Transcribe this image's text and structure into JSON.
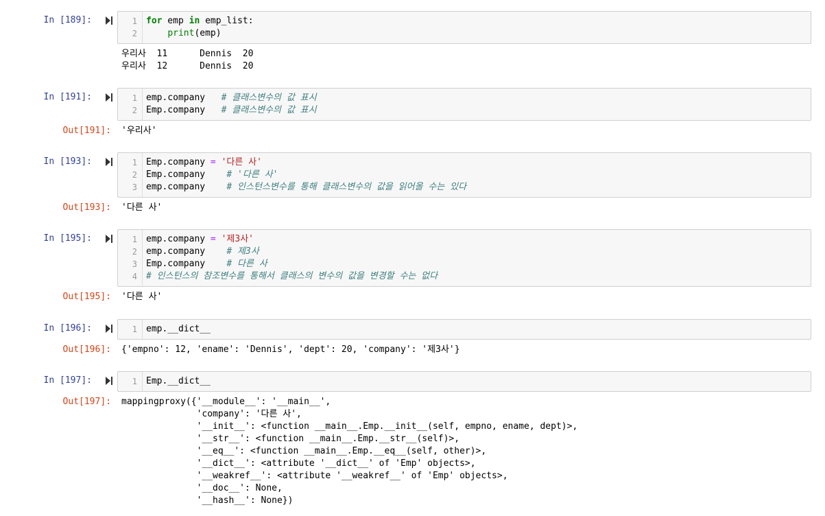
{
  "cells": [
    {
      "prompt": "In [189]:",
      "code": [
        {
          "no": "1",
          "parts": [
            {
              "t": "for",
              "c": "kw"
            },
            {
              "t": " emp "
            },
            {
              "t": "in",
              "c": "kw"
            },
            {
              "t": " emp_list:"
            }
          ]
        },
        {
          "no": "2",
          "parts": [
            {
              "t": "    "
            },
            {
              "t": "print",
              "c": "bi"
            },
            {
              "t": "(emp)"
            }
          ]
        }
      ],
      "output_prompt": "",
      "output": [
        "우리사  11      Dennis  20",
        "우리사  12      Dennis  20"
      ]
    },
    {
      "prompt": "In [191]:",
      "code": [
        {
          "no": "1",
          "parts": [
            {
              "t": "emp.company   "
            },
            {
              "t": "# 클래스변수의 값 표시",
              "c": "cm"
            }
          ]
        },
        {
          "no": "2",
          "parts": [
            {
              "t": "Emp.company   "
            },
            {
              "t": "# 클래스변수의 값 표시",
              "c": "cm"
            }
          ]
        }
      ],
      "output_prompt": "Out[191]:",
      "output": [
        "'우리사'"
      ]
    },
    {
      "prompt": "In [193]:",
      "code": [
        {
          "no": "1",
          "parts": [
            {
              "t": "Emp.company "
            },
            {
              "t": "=",
              "c": "op"
            },
            {
              "t": " "
            },
            {
              "t": "'다른 사'",
              "c": "str"
            }
          ]
        },
        {
          "no": "2",
          "parts": [
            {
              "t": "Emp.company    "
            },
            {
              "t": "# '다른 사'",
              "c": "cm"
            }
          ]
        },
        {
          "no": "3",
          "parts": [
            {
              "t": "emp.company    "
            },
            {
              "t": "# 인스턴스변수를 통해 클래스변수의 값을 읽어올 수는 있다",
              "c": "cm"
            }
          ]
        }
      ],
      "output_prompt": "Out[193]:",
      "output": [
        "'다른 사'"
      ]
    },
    {
      "prompt": "In [195]:",
      "code": [
        {
          "no": "1",
          "parts": [
            {
              "t": "emp.company "
            },
            {
              "t": "=",
              "c": "op"
            },
            {
              "t": " "
            },
            {
              "t": "'제3사'",
              "c": "str"
            }
          ]
        },
        {
          "no": "2",
          "parts": [
            {
              "t": "emp.company    "
            },
            {
              "t": "# 제3사",
              "c": "cm"
            }
          ]
        },
        {
          "no": "3",
          "parts": [
            {
              "t": "Emp.company    "
            },
            {
              "t": "# 다른 사",
              "c": "cm"
            }
          ]
        },
        {
          "no": "4",
          "parts": [
            {
              "t": "# 인스턴스의 참조변수를 통해서 클래스의 변수의 값을 변경할 수는 없다",
              "c": "cm"
            }
          ]
        }
      ],
      "output_prompt": "Out[195]:",
      "output": [
        "'다른 사'"
      ]
    },
    {
      "prompt": "In [196]:",
      "code": [
        {
          "no": "1",
          "parts": [
            {
              "t": "emp.__dict__"
            }
          ]
        }
      ],
      "output_prompt": "Out[196]:",
      "output": [
        "{'empno': 12, 'ename': 'Dennis', 'dept': 20, 'company': '제3사'}"
      ]
    },
    {
      "prompt": "In [197]:",
      "code": [
        {
          "no": "1",
          "parts": [
            {
              "t": "Emp.__dict__"
            }
          ]
        }
      ],
      "output_prompt": "Out[197]:",
      "output": [
        "mappingproxy({'__module__': '__main__',",
        "              'company': '다른 사',",
        "              '__init__': <function __main__.Emp.__init__(self, empno, ename, dept)>,",
        "              '__str__': <function __main__.Emp.__str__(self)>,",
        "              '__eq__': <function __main__.Emp.__eq__(self, other)>,",
        "              '__dict__': <attribute '__dict__' of 'Emp' objects>,",
        "              '__weakref__': <attribute '__weakref__' of 'Emp' objects>,",
        "              '__doc__': None,",
        "              '__hash__': None})"
      ]
    }
  ],
  "icons": {
    "run": "run-cell-icon"
  },
  "colors": {
    "in_prompt": "#303f9f",
    "out_prompt": "#d84315",
    "keyword": "#008000",
    "string": "#ba2121",
    "comment": "#408080"
  }
}
